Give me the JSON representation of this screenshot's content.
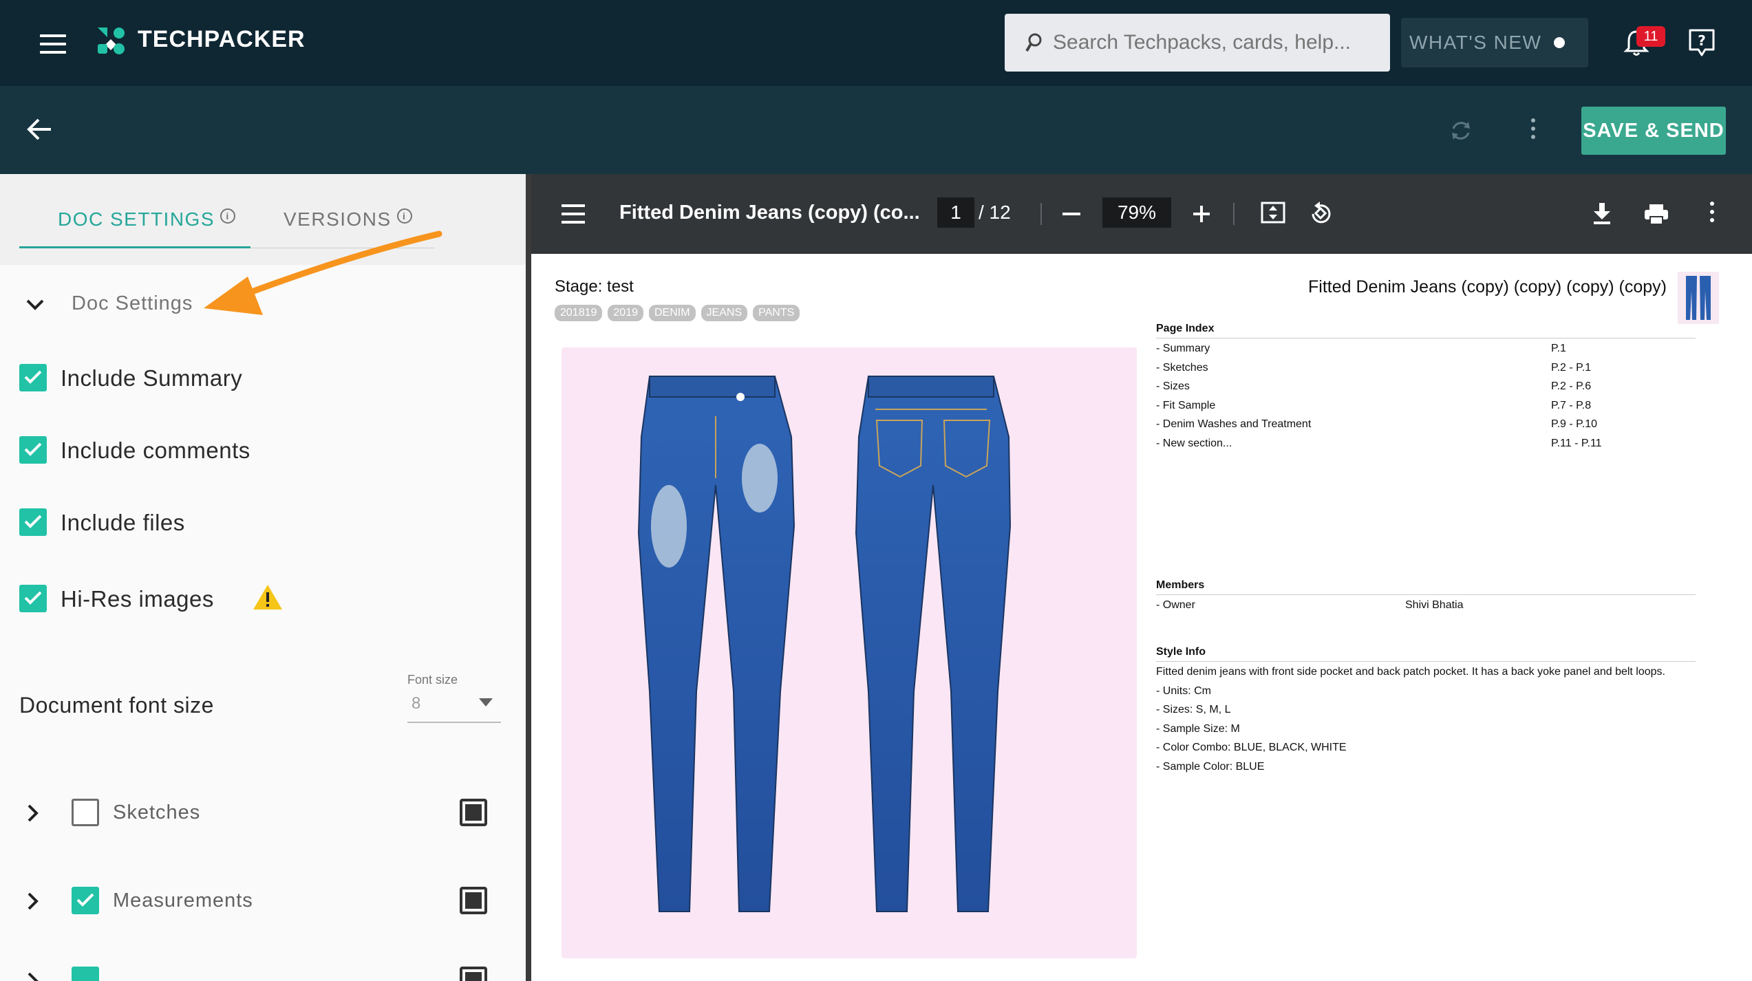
{
  "app": {
    "brand": "TECHPACKER",
    "search_placeholder": "Search Techpacks, cards, help...",
    "whats_new": "WHAT'S NEW",
    "notification_count": "11",
    "save_send": "SAVE & SEND",
    "colors": {
      "header": "#0f2733",
      "subheader": "#173540",
      "accent": "#26a69a",
      "save": "#3aa88f",
      "badge": "#e0192a"
    }
  },
  "left_panel": {
    "tabs": [
      {
        "label": "DOC SETTINGS",
        "active": true
      },
      {
        "label": "VERSIONS",
        "active": false
      }
    ],
    "section_title": "Doc Settings",
    "options": [
      {
        "label": "Include Summary",
        "checked": true
      },
      {
        "label": "Include comments",
        "checked": true
      },
      {
        "label": "Include files",
        "checked": true
      },
      {
        "label": "Hi-Res images",
        "checked": true,
        "warning": true
      }
    ],
    "font_size": {
      "label": "Document font size",
      "caption": "Font size",
      "value": "8"
    },
    "sections": [
      {
        "label": "Sketches",
        "checked": false,
        "layout_icon": "full-layout-icon"
      },
      {
        "label": "Measurements",
        "checked": true,
        "layout_icon": "split-layout-icon"
      }
    ]
  },
  "pdf_viewer": {
    "title": "Fitted Denim Jeans (copy) (co...",
    "current_page": "1",
    "total_pages": "/ 12",
    "zoom": "79%"
  },
  "pdf_page": {
    "stage": "Stage: test",
    "tags": [
      "201819",
      "2019",
      "DENIM",
      "JEANS",
      "PANTS"
    ],
    "title": "Fitted Denim Jeans (copy) (copy) (copy) (copy)",
    "page_index": {
      "heading": "Page Index",
      "rows": [
        {
          "name": "- Summary",
          "pages": "P.1"
        },
        {
          "name": "- Sketches",
          "pages": "P.2 - P.1"
        },
        {
          "name": "- Sizes",
          "pages": "P.2 - P.6"
        },
        {
          "name": "- Fit Sample",
          "pages": "P.7 - P.8"
        },
        {
          "name": "- Denim Washes and Treatment",
          "pages": "P.9 - P.10"
        },
        {
          "name": "- New section...",
          "pages": "P.11 - P.11"
        }
      ]
    },
    "members": {
      "heading": "Members",
      "rows": [
        {
          "role": "- Owner",
          "name": "Shivi Bhatia"
        }
      ]
    },
    "style_info": {
      "heading": "Style Info",
      "lines": [
        "Fitted denim jeans with front side pocket and back patch pocket. It has a back yoke panel and belt loops.",
        "- Units: Cm",
        "- Sizes: S, M, L",
        "- Sample Size: M",
        "- Color Combo: BLUE, BLACK, WHITE",
        "- Sample Color: BLUE"
      ]
    }
  }
}
